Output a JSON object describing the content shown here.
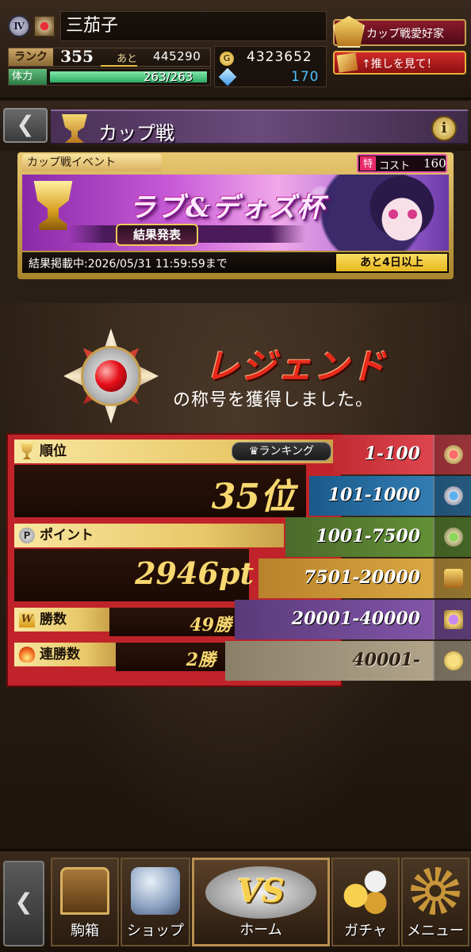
{
  "player": {
    "tier_badge": "Ⅳ",
    "name": "三茄子",
    "rank_label": "ランク",
    "rank": "355",
    "next_label": "あと",
    "next_exp": "445290",
    "hp_label": "体力",
    "hp": "263/263",
    "hp_fraction": 1.0,
    "coins": "4323652",
    "gems": "170",
    "coin_symbol": "G"
  },
  "title_badge": "カップ戦愛好家",
  "oshi_button": "↑推しを見て！",
  "header": {
    "back_symbol": "❮",
    "title": "カップ戦",
    "info_symbol": "i"
  },
  "event": {
    "tab_label": "カップ戦イベント",
    "cost_mark": "特",
    "cost_label": "コスト",
    "cost_value": "160",
    "logo": "ラブ&デォズ杯",
    "result_badge": "結果発表",
    "period": "結果掲載中:2026/05/31 11:59:59まで",
    "remaining": "あと4日以上"
  },
  "result": {
    "title_name": "レジェンド",
    "caption": "の称号を獲得しました。",
    "rank_label": "順位",
    "ranking_button": "♛ランキング",
    "rank_value": "35位",
    "point_label": "ポイント",
    "point_value": "2946pt",
    "win_label": "勝数",
    "win_value": "49勝",
    "streak_label": "連勝数",
    "streak_value": "2勝",
    "point_icon": "P",
    "win_icon": "W"
  },
  "tiers": [
    {
      "range": "1-100",
      "color": "#c22a32"
    },
    {
      "range": "101-1000",
      "color": "#1a5a8a"
    },
    {
      "range": "1001-7500",
      "color": "#4a6a2a"
    },
    {
      "range": "7501-20000",
      "color": "#b8822a"
    },
    {
      "range": "20001-40000",
      "color": "#5a3a7a"
    },
    {
      "range": "40001-",
      "color": "#8a806a"
    }
  ],
  "nav": {
    "back_symbol": "❮",
    "box": "駒箱",
    "shop": "ショップ",
    "home": "ホーム",
    "home_logo": "VS",
    "gacha": "ガチャ",
    "menu": "メニュー"
  }
}
